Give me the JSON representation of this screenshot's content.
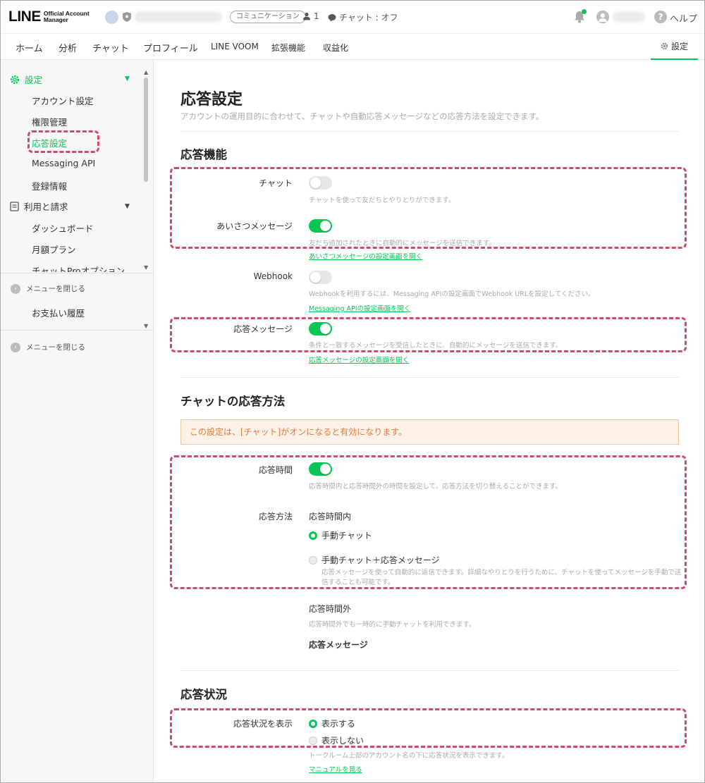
{
  "topbar": {
    "logo": "LINE",
    "logo_sub": "Official Account Manager",
    "pill": "コミュニケーション",
    "friend_count": "1",
    "chat_status": "チャット : オフ",
    "help": "ヘルプ"
  },
  "nav": {
    "items": [
      "ホーム",
      "分析",
      "チャット",
      "プロフィール",
      "LINE VOOM",
      "拡張機能",
      "収益化"
    ],
    "settings": "設定"
  },
  "sidebar": {
    "group_settings": "設定",
    "items": [
      "アカウント設定",
      "権限管理",
      "応答設定",
      "Messaging API",
      "登録情報"
    ],
    "group_billing": "利用と請求",
    "billing_items": [
      "ダッシュボード",
      "月額プラン",
      "チャットProオプション"
    ],
    "close_menu": "メニューを閉じる",
    "payment_history": "お支払い履歴",
    "close_menu2": "メニューを閉じる"
  },
  "main": {
    "title": "応答設定",
    "subtitle": "アカウントの運用目的に合わせて、チャットや自動応答メッセージなどの応答方法を設定できます。",
    "section1": "応答機能",
    "chat_label": "チャット",
    "chat_desc": "チャットを使って友だちとやりとりができます。",
    "chat_on": false,
    "greet_label": "あいさつメッセージ",
    "greet_desc": "友だち追加されたときに自動的にメッセージを送信できます。",
    "greet_link": "あいさつメッセージの設定画面を開く",
    "greet_on": true,
    "webhook_label": "Webhook",
    "webhook_desc": "Webhookを利用するには、Messaging APIの設定画面でWebhook URLを設定してください。",
    "webhook_link": "Messaging APIの設定画面を開く",
    "webhook_on": false,
    "auto_label": "応答メッセージ",
    "auto_desc": "条件と一致するメッセージを受信したときに、自動的にメッセージを送信できます。",
    "auto_link": "応答メッセージの設定画面を開く",
    "auto_on": true,
    "section2": "チャットの応答方法",
    "warning": "この設定は、[チャット]がオンになると有効になります。",
    "hours_label": "応答時間",
    "hours_desc": "応答時間内と応答時間外の時間を設定して、応答方法を切り替えることができます。",
    "hours_on": true,
    "method_label": "応答方法",
    "within_hours": "応答時間内",
    "opt_manual": "手動チャット",
    "opt_manual_auto": "手動チャット＋応答メッセージ",
    "opt_manual_auto_desc1": "応答メッセージを使って自動的に返信できます。詳細なやりとりを行うために、チャットを使ってメッセージを手動で送",
    "opt_manual_auto_desc2": "信することも可能です。",
    "outside_hours": "応答時間外",
    "outside_desc": "応答時間外でも一時的に手動チャットを利用できます。",
    "outside_value": "応答メッセージ",
    "section3": "応答状況",
    "status_label": "応答状況を表示",
    "status_show": "表示する",
    "status_hide": "表示しない",
    "status_desc": "トークルーム上部のアカウント名の下に応答状況を表示できます。",
    "manual_link": "マニュアルを見る"
  },
  "colors": {
    "accent": "#06c755",
    "highlight": "#d14a6a",
    "warning_text": "#e07b39"
  }
}
